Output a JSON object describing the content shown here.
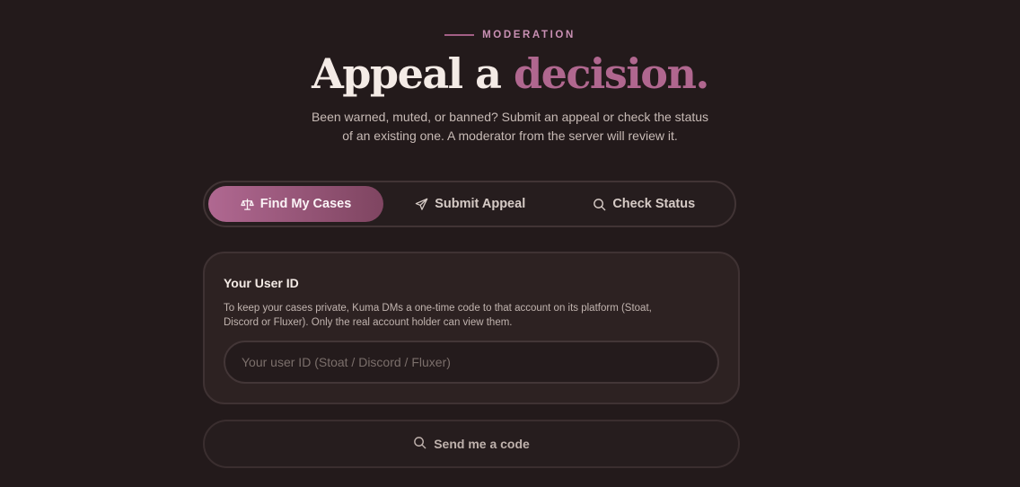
{
  "header": {
    "eyebrow": "MODERATION",
    "title_main": "Appeal a",
    "title_accent": "decision.",
    "subtitle_line1": "Been warned, muted, or banned? Submit an appeal or check the status",
    "subtitle_line2": "of an existing one. A moderator from the server will review it."
  },
  "tabs": [
    {
      "label": "Find My Cases",
      "icon": "scales-icon",
      "active": true
    },
    {
      "label": "Submit Appeal",
      "icon": "send-icon",
      "active": false
    },
    {
      "label": "Check Status",
      "icon": "search-icon",
      "active": false
    }
  ],
  "card": {
    "title": "Your User ID",
    "description_line1": "To keep your cases private, Kuma DMs a one-time code to that account on its platform (Stoat,",
    "description_line2": "Discord or Fluxer). Only the real account holder can view them.",
    "input_value": "",
    "input_placeholder": "Your user ID (Stoat / Discord / Fluxer)"
  },
  "send_button": {
    "label": "Send me a code",
    "icon": "search-icon"
  },
  "colors": {
    "background": "#231a1b",
    "accent": "#b0678f",
    "accent_dark": "#7f4561",
    "text": "#f4ebe6",
    "muted_text": "#c8bbb6"
  }
}
